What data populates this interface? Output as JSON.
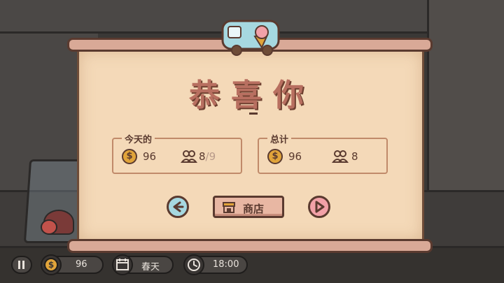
{
  "dialog": {
    "title": "恭喜你",
    "today": {
      "label": "今天的",
      "coins": "96",
      "customers_served": "8",
      "customers_separator": "/",
      "customers_total": "9"
    },
    "total": {
      "label": "总计",
      "coins": "96",
      "customers": "8"
    },
    "shop_button": "商店"
  },
  "hud": {
    "coins": "96",
    "season": "春天",
    "time": "18:00"
  },
  "icons": {
    "truck": "ice-cream-truck-icon",
    "coin": "coin-icon",
    "people": "people-icon",
    "back": "back-arrow-icon",
    "play": "play-icon",
    "shop": "shop-icon",
    "pause": "pause-icon",
    "calendar": "calendar-icon",
    "clock": "clock-icon"
  },
  "colors": {
    "parchment": "#f4d9b8",
    "title": "#b86f60",
    "back_button": "#a6d8e0",
    "play_button": "#f2a1a8",
    "shop_button": "#e8b7a3"
  }
}
